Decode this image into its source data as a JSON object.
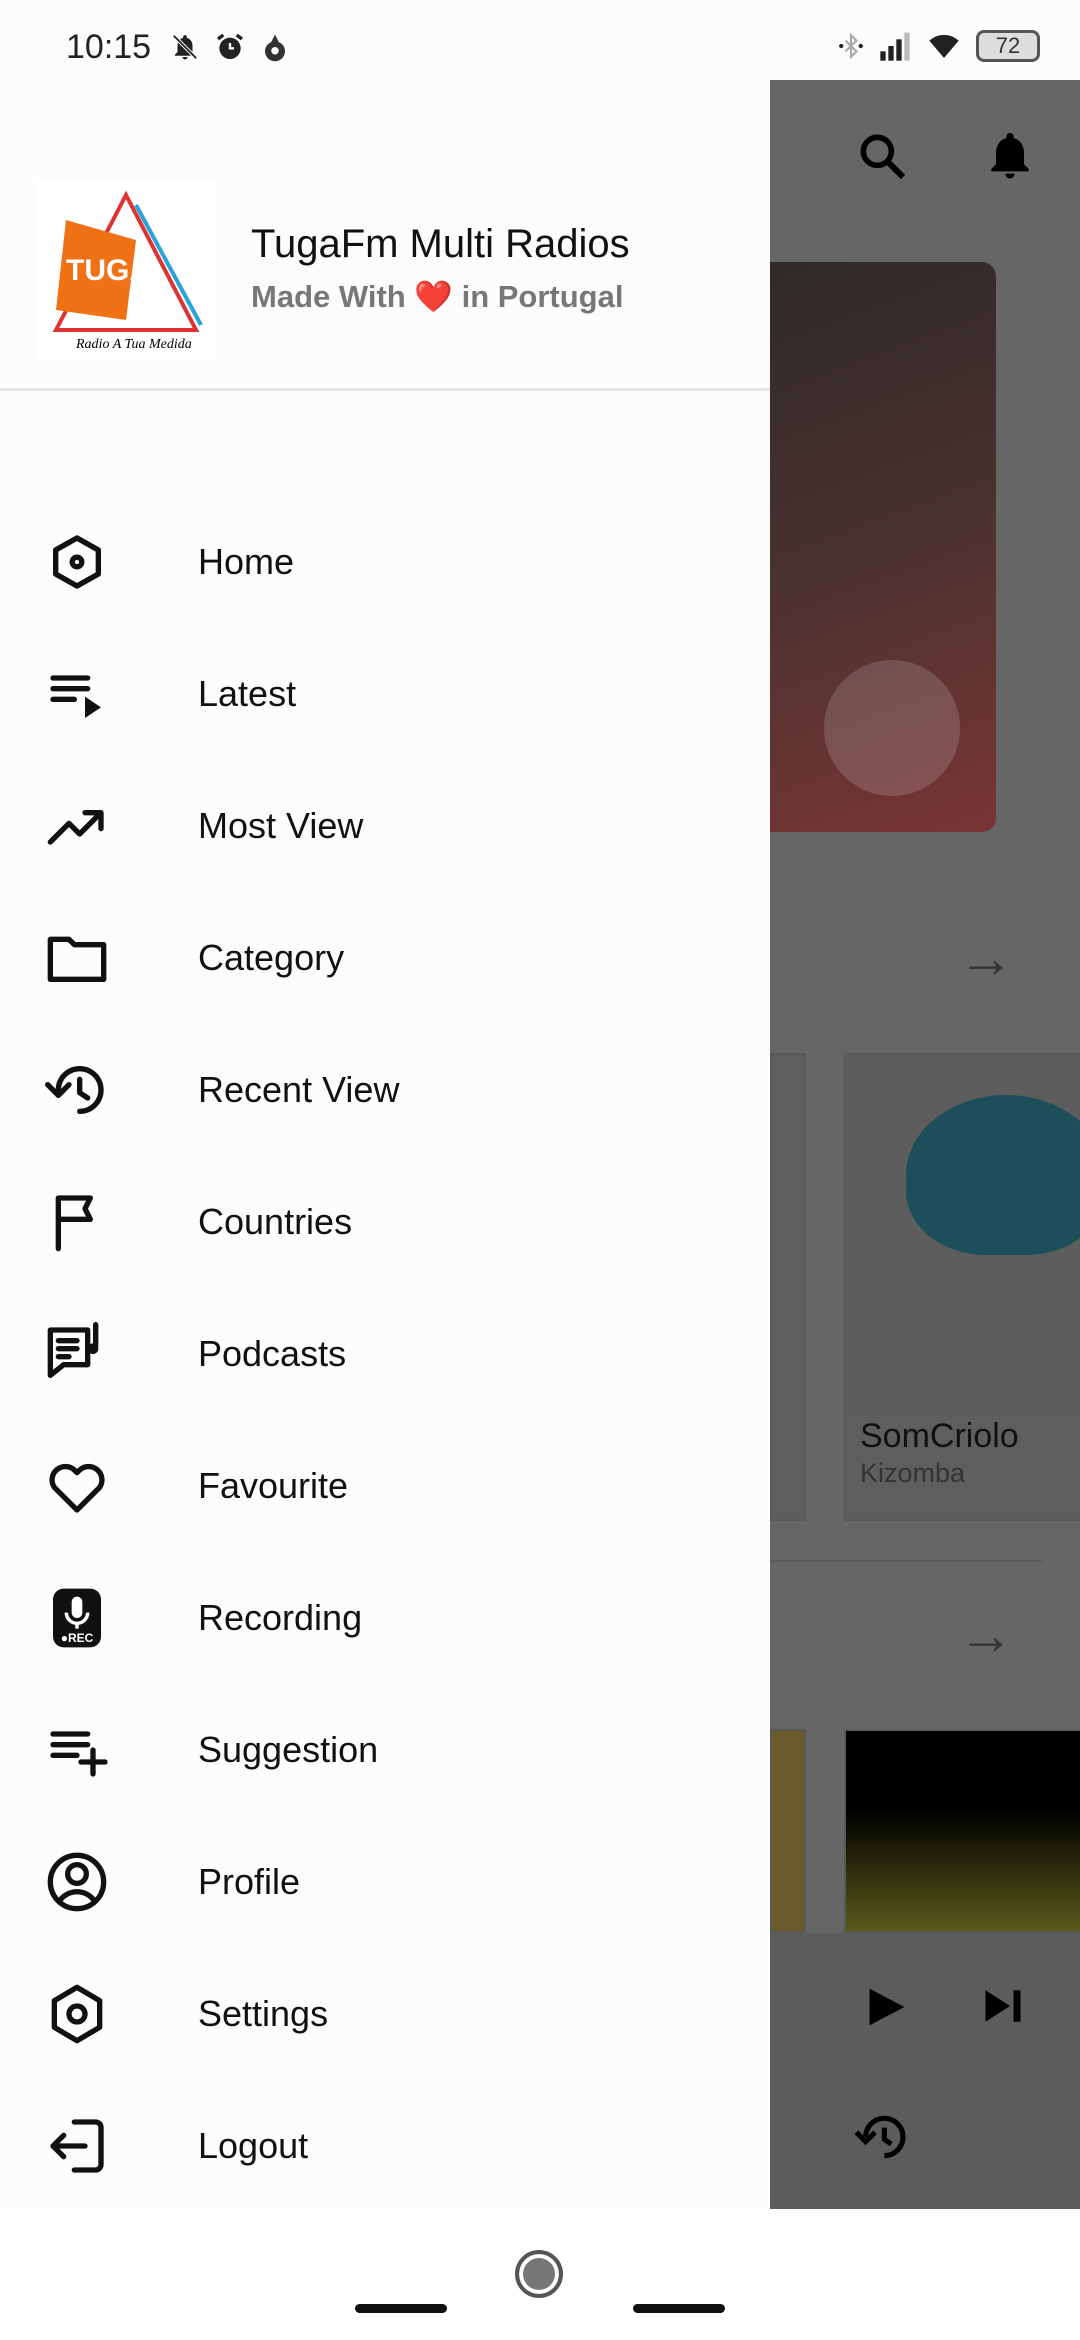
{
  "status_bar": {
    "time": "10:15",
    "battery": "72"
  },
  "drawer": {
    "app_title": "TugaFm Multi Radios",
    "subtitle_before": "Made With",
    "subtitle_heart": "❤️",
    "subtitle_after": "in Portugal",
    "logo_text": "TUGA FM Radio A Tua Medida",
    "items": [
      {
        "label": "Home",
        "icon": "home-icon"
      },
      {
        "label": "Latest",
        "icon": "playlist-icon"
      },
      {
        "label": "Most View",
        "icon": "trending-up-icon"
      },
      {
        "label": "Category",
        "icon": "folder-icon"
      },
      {
        "label": "Recent View",
        "icon": "history-icon"
      },
      {
        "label": "Countries",
        "icon": "flag-icon"
      },
      {
        "label": "Podcasts",
        "icon": "podcast-icon"
      },
      {
        "label": "Favourite",
        "icon": "heart-icon"
      },
      {
        "label": "Recording",
        "icon": "recording-icon"
      },
      {
        "label": "Suggestion",
        "icon": "playlist-add-icon"
      },
      {
        "label": "Profile",
        "icon": "profile-icon"
      },
      {
        "label": "Settings",
        "icon": "settings-icon"
      },
      {
        "label": "Logout",
        "icon": "logout-icon"
      }
    ]
  },
  "background": {
    "card_title": "SomCriolo",
    "card_subtitle": "Kizomba"
  }
}
